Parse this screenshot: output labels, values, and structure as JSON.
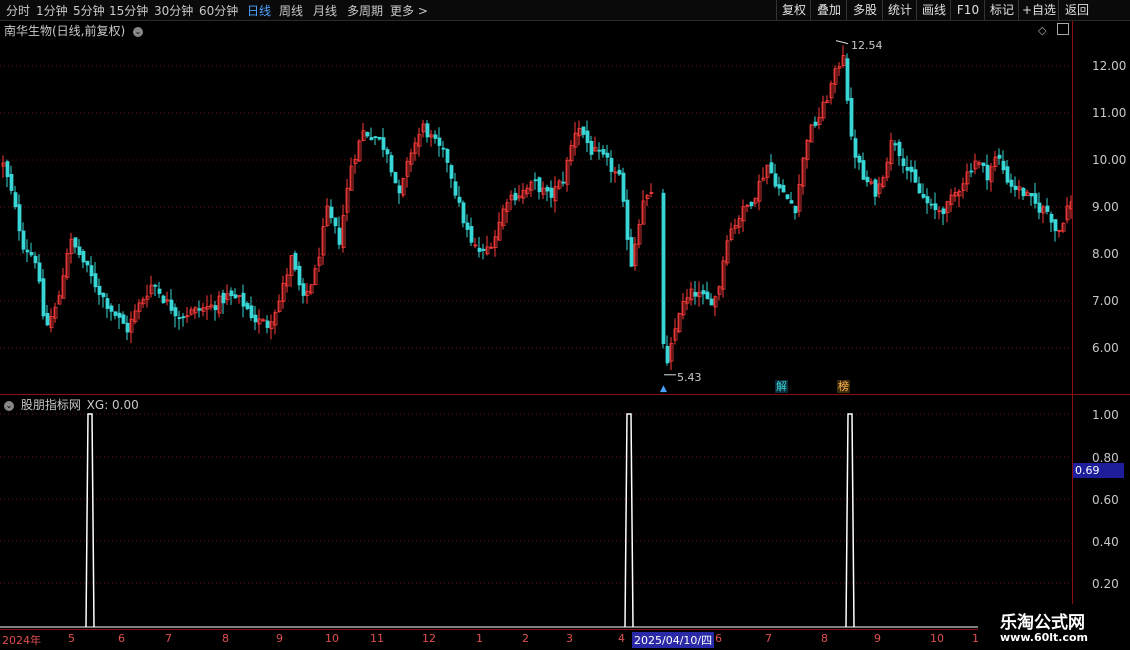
{
  "periods": [
    "分时",
    "1分钟",
    "5分钟",
    "15分钟",
    "30分钟",
    "60分钟",
    "日线",
    "周线",
    "月线",
    "多周期",
    "更多 >"
  ],
  "toolbar": [
    "复权",
    "叠加",
    "多股",
    "统计",
    "画线",
    "F10",
    "标记",
    "+自选",
    "返回"
  ],
  "main": {
    "title": "南华生物(日线,前复权)",
    "high_label": "12.54",
    "low_label": "5.43",
    "signal_jie": "解",
    "signal_bang": "榜",
    "yaxis": [
      "12.00",
      "11.00",
      "10.00",
      "9.00",
      "8.00",
      "7.00",
      "6.00"
    ]
  },
  "indicator": {
    "title": "股朋指标网",
    "value_text": "XG: 0.00",
    "yaxis": [
      "1.00",
      "0.80",
      "0.60",
      "0.40",
      "0.20"
    ],
    "cursor_value": "0.69"
  },
  "xaxis": [
    "2024年",
    "5",
    "6",
    "7",
    "8",
    "9",
    "10",
    "11",
    "12",
    "1",
    "2",
    "3",
    "4",
    "2025/04/10/四",
    "6",
    "7",
    "8",
    "9",
    "10",
    "1"
  ],
  "watermark": {
    "line1": "乐淘公式网",
    "line2": "www.60lt.com"
  },
  "colors": {
    "up": "#ff3c3c",
    "down": "#39d6d6",
    "grid": "#6a0f0f",
    "axis": "#8a1010",
    "pulse": "#ffffff"
  }
}
